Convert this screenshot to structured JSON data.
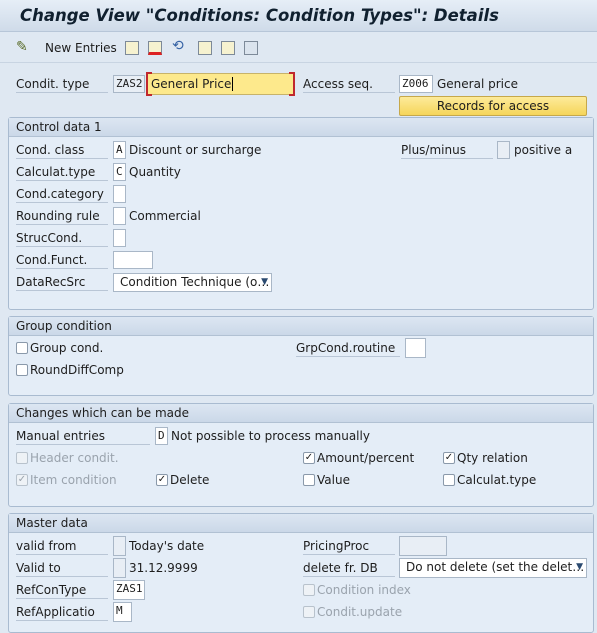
{
  "window": {
    "title": "Change View \"Conditions: Condition Types\": Details"
  },
  "toolbar": {
    "new_entries": "New Entries",
    "icons": [
      "pencil-glasses-icon",
      "copy-icon",
      "delete-icon",
      "undo-icon",
      "previous-entry-icon",
      "next-entry-icon",
      "select-all-icon"
    ]
  },
  "header": {
    "condit_type_label": "Condit. type",
    "condit_type_value": "ZAS2",
    "condit_type_desc": "General Price",
    "access_seq_label": "Access seq.",
    "access_seq_value": "Z006",
    "access_seq_desc": "General price",
    "records_button": "Records for access"
  },
  "control_data": {
    "title": "Control data 1",
    "cond_class_label": "Cond. class",
    "cond_class_value": "A",
    "cond_class_desc": "Discount or surcharge",
    "calc_type_label": "Calculat.type",
    "calc_type_value": "C",
    "calc_type_desc": "Quantity",
    "cond_category_label": "Cond.category",
    "cond_category_value": "",
    "rounding_label": "Rounding rule",
    "rounding_value": "",
    "rounding_desc": "Commercial",
    "struc_label": "StrucCond.",
    "struc_value": "",
    "funct_label": "Cond.Funct.",
    "funct_value": "",
    "datarec_label": "DataRecSrc",
    "datarec_value": "Condition Technique (o…",
    "plusminus_label": "Plus/minus",
    "plusminus_value": "",
    "plusminus_desc": "positive a"
  },
  "group_condition": {
    "title": "Group condition",
    "group_cond": {
      "label": "Group cond.",
      "checked": false
    },
    "rounddiff": {
      "label": "RoundDiffComp",
      "checked": false
    },
    "routine_label": "GrpCond.routine",
    "routine_value": ""
  },
  "changes": {
    "title": "Changes which can be made",
    "manual_label": "Manual entries",
    "manual_value": "D",
    "manual_desc": "Not possible to process manually",
    "header_condit": {
      "label": "Header condit.",
      "checked": false,
      "disabled": true
    },
    "amount_percent": {
      "label": "Amount/percent",
      "checked": true
    },
    "qty_relation": {
      "label": "Qty relation",
      "checked": true
    },
    "item_condition": {
      "label": "Item condition",
      "checked": true,
      "disabled": true
    },
    "delete": {
      "label": "Delete",
      "checked": true
    },
    "value": {
      "label": "Value",
      "checked": false
    },
    "calc_type": {
      "label": "Calculat.type",
      "checked": false
    }
  },
  "master_data": {
    "title": "Master data",
    "valid_from_label": "valid from",
    "valid_from_value": "",
    "valid_from_desc": "Today's date",
    "valid_to_label": "Valid to",
    "valid_to_value": "",
    "valid_to_desc": "31.12.9999",
    "refcon_label": "RefConType",
    "refcon_value": "ZAS1",
    "refapp_label": "RefApplicatio",
    "refapp_value": "M",
    "pricing_label": "PricingProc",
    "pricing_value": "",
    "delete_db_label": "delete fr. DB",
    "delete_db_value": "Do not delete (set the delet…",
    "condition_index": {
      "label": "Condition index",
      "checked": false,
      "disabled": true
    },
    "condit_update": {
      "label": "Condit.update",
      "checked": false,
      "disabled": true
    }
  },
  "colors": {
    "input_highlight": "#fde98c",
    "button": "#f9dd6f",
    "focus_bracket": "#c0282d"
  }
}
